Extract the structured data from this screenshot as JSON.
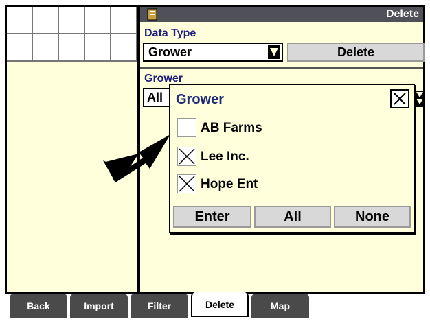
{
  "header": {
    "title": "Delete",
    "icon": "page-icon"
  },
  "data_type": {
    "label": "Data Type",
    "value": "Grower",
    "action_label": "Delete"
  },
  "grower": {
    "label": "Grower",
    "value": "All"
  },
  "popup": {
    "title": "Grower",
    "options": [
      {
        "label": "AB Farms",
        "checked": false
      },
      {
        "label": "Lee Inc.",
        "checked": true
      },
      {
        "label": "Hope Ent",
        "checked": true
      }
    ],
    "buttons": {
      "enter": "Enter",
      "all": "All",
      "none": "None"
    }
  },
  "tabs": [
    {
      "label": "Back",
      "active": false
    },
    {
      "label": "Import",
      "active": false
    },
    {
      "label": "Filter",
      "active": false
    },
    {
      "label": "Delete",
      "active": true
    },
    {
      "label": "Map",
      "active": false
    }
  ],
  "colors": {
    "panel": "#ffffdc",
    "titlebar": "#505058",
    "label": "#1c1c80"
  }
}
